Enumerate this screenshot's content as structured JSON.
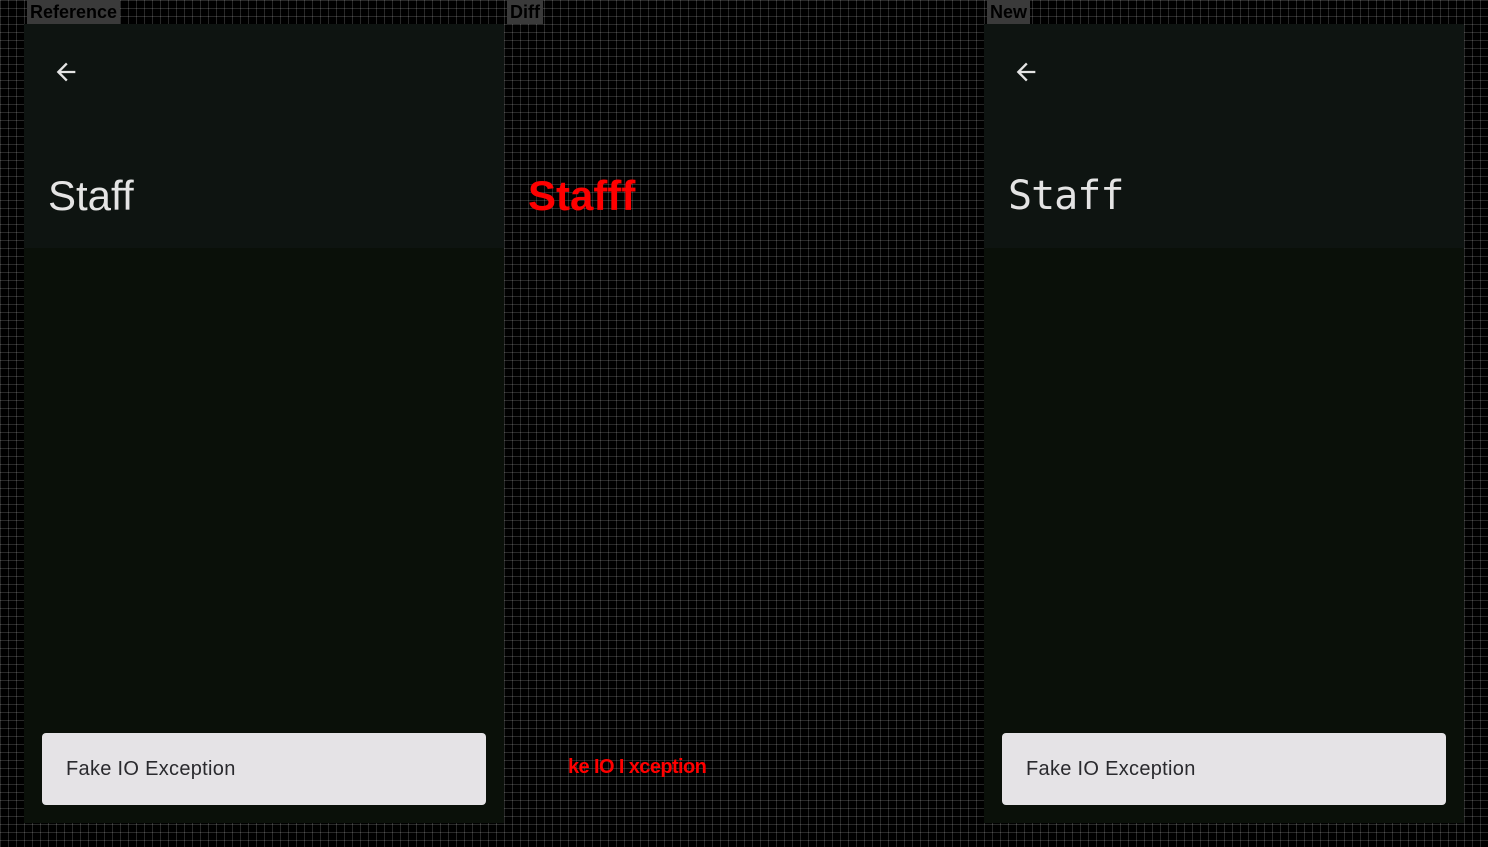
{
  "labels": {
    "reference": "Reference",
    "diff": "Diff",
    "new": "New"
  },
  "reference": {
    "title": "Staff",
    "back_icon": "arrow-back-icon",
    "snackbar_text": "Fake IO Exception"
  },
  "diff": {
    "title": "Stafff",
    "snackbar_text": "ke IO I xception"
  },
  "new": {
    "title": "Staff",
    "back_icon": "arrow-back-icon",
    "snackbar_text": "Fake IO Exception"
  },
  "colors": {
    "appbar": "#0e1411",
    "content": "#0a1009",
    "snackbar": "#e5e3e6",
    "diff_highlight": "#ff0000"
  }
}
